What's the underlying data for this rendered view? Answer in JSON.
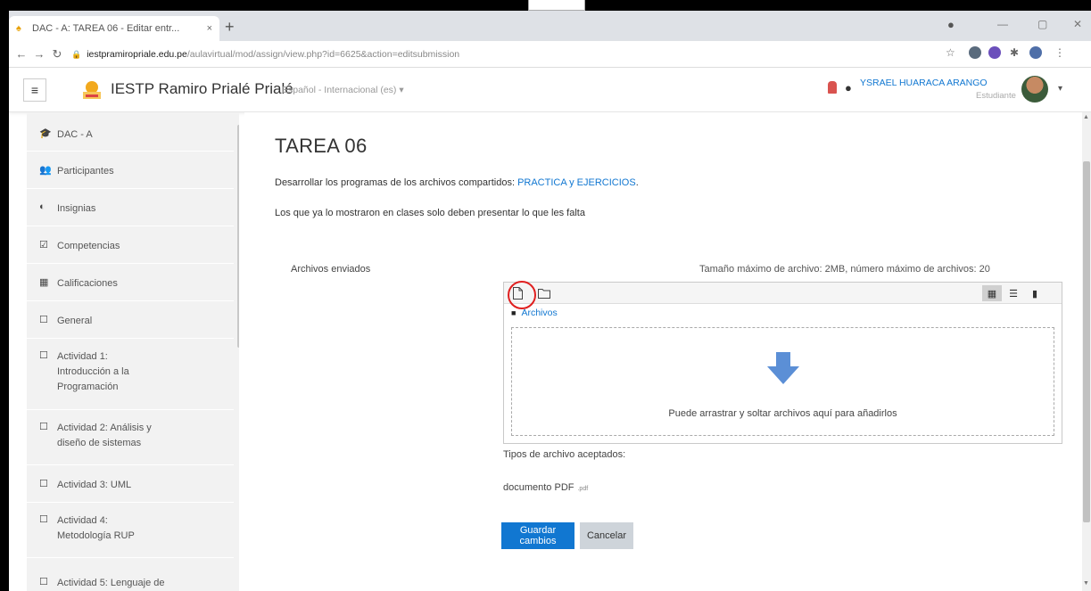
{
  "browser": {
    "tab_title": "DAC - A: TAREA 06 - Editar entr...",
    "close_glyph": "×",
    "new_tab_glyph": "+",
    "url_host": "iestpramiropriale.edu.pe",
    "url_path": "/aulavirtual/mod/assign/view.php?id=6625&action=editsubmission",
    "window_controls": [
      "—",
      "▢",
      "✕"
    ]
  },
  "navbar": {
    "menu_glyph": "≡",
    "site_name": "IESTP Ramiro Prialé Prialé",
    "language": "Español - Internacional (es) ▾",
    "user_name": "YSRAEL HUARACA ARANGO",
    "user_role": "Estudiante",
    "caret": "▾"
  },
  "drawer": {
    "items": [
      {
        "icon": "graduation-cap-icon",
        "glyph": "🎓",
        "label": "DAC - A"
      },
      {
        "icon": "users-icon",
        "glyph": "👥",
        "label": "Participantes"
      },
      {
        "icon": "shield-icon",
        "glyph": "◐",
        "label": "Insignias"
      },
      {
        "icon": "checkbox-icon",
        "glyph": "☑",
        "label": "Competencias"
      },
      {
        "icon": "table-icon",
        "glyph": "▦",
        "label": "Calificaciones"
      },
      {
        "icon": "folder-icon",
        "glyph": "☐",
        "label": "General"
      },
      {
        "icon": "folder-icon",
        "glyph": "☐",
        "label": "Actividad 1: Introducción a la Programación"
      },
      {
        "icon": "folder-icon",
        "glyph": "☐",
        "label": "Actividad 2: Análisis y diseño de sistemas"
      },
      {
        "icon": "folder-icon",
        "glyph": "☐",
        "label": "Actividad 3: UML"
      },
      {
        "icon": "folder-icon",
        "glyph": "☐",
        "label": "Actividad 4: Metodología RUP"
      },
      {
        "icon": "folder-icon",
        "glyph": "☐",
        "label": "Actividad 5: Lenguaje de"
      }
    ]
  },
  "main": {
    "title": "TAREA 06",
    "description_prefix": "Desarrollar los programas de los archivos compartidos: ",
    "description_link": "PRACTICA y EJERCICIOS",
    "description_suffix": ".",
    "description_2": "Los que ya lo mostraron en clases solo deben presentar lo que les falta",
    "files_label": "Archivos enviados",
    "max_info": "Tamaño máximo de archivo: 2MB, número máximo de archivos: 20",
    "folder_path": "Archivos",
    "drop_text": "Puede arrastrar y soltar archivos aquí para añadirlos",
    "accepted_label": "Tipos de archivo aceptados:",
    "file_type": "documento PDF",
    "file_ext": ".pdf",
    "save_button": "Guardar cambios",
    "cancel_button": "Cancelar"
  },
  "colors": {
    "accent": "#1177d1",
    "annotation": "#e02020"
  }
}
